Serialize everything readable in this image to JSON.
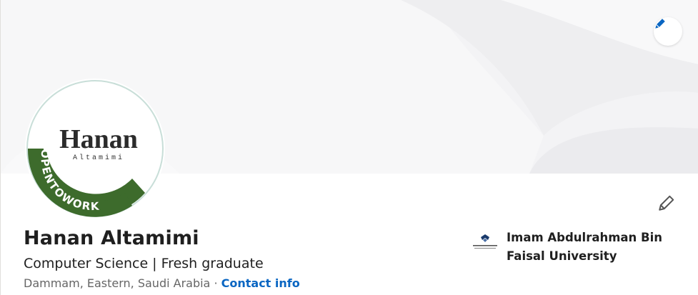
{
  "profile": {
    "name": "Hanan Altamimi",
    "headline": "Computer Science | Fresh graduate",
    "location": "Dammam, Eastern, Saudi Arabia",
    "separator": " · ",
    "contact_info_label": "Contact info"
  },
  "avatar": {
    "logo_main": "Hanan",
    "logo_sub": "Altamimi",
    "frame_text": "#OPENTOWORK",
    "frame_color": "#3d6b2c"
  },
  "education": {
    "name": "Imam Abdulrahman Bin Faisal University"
  },
  "icons": {
    "banner_edit": "pencil-icon",
    "profile_edit": "pencil-icon"
  },
  "colors": {
    "link": "#0a66c2",
    "text": "#1f1f1f",
    "muted": "#666666"
  }
}
